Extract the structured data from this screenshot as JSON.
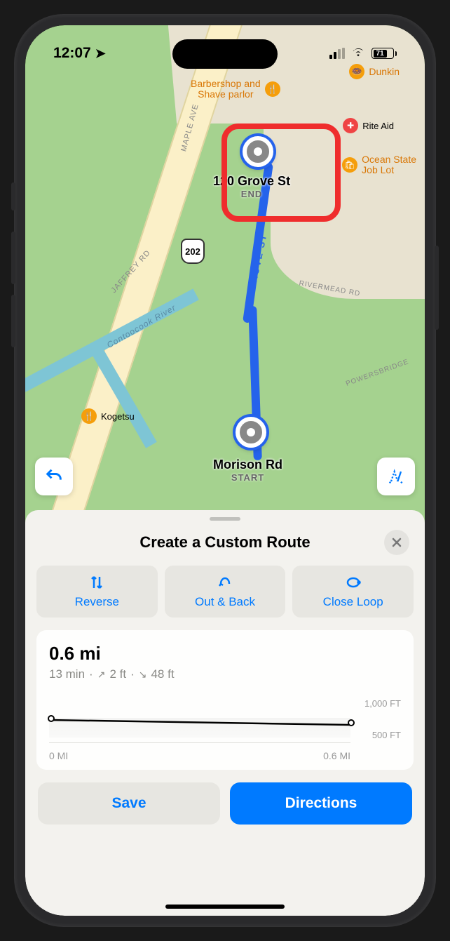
{
  "status_bar": {
    "time": "12:07",
    "battery_pct": "71"
  },
  "map": {
    "pois": {
      "barbershop": "Barbershop and\nShave parlor",
      "dunkin": "Dunkin",
      "riteaid": "Rite Aid",
      "ocean_state": "Ocean State\nJob Lot",
      "kogetsu": "Kogetsu"
    },
    "streets": {
      "maple": "MAPLE AVE",
      "jaffrey": "JAFFREY RD",
      "rivermead": "RIVERMEAD RD",
      "powers": "POWERSBRIDGE",
      "grove": "GROVE ST",
      "river_name": "Contoocook River"
    },
    "route_shield": "202",
    "end_point": {
      "title": "120 Grove St",
      "sub": "END"
    },
    "start_point": {
      "title": "Morison Rd",
      "sub": "START"
    }
  },
  "sheet": {
    "title": "Create a Custom Route",
    "actions": {
      "reverse": "Reverse",
      "out_back": "Out & Back",
      "close_loop": "Close Loop"
    },
    "distance": "0.6 mi",
    "time": "13 min",
    "elev_up": "2 ft",
    "elev_down": "48 ft",
    "elev_top": "1,000 FT",
    "elev_bot": "500 FT",
    "x_start": "0 MI",
    "x_end": "0.6 MI",
    "save": "Save",
    "directions": "Directions"
  }
}
